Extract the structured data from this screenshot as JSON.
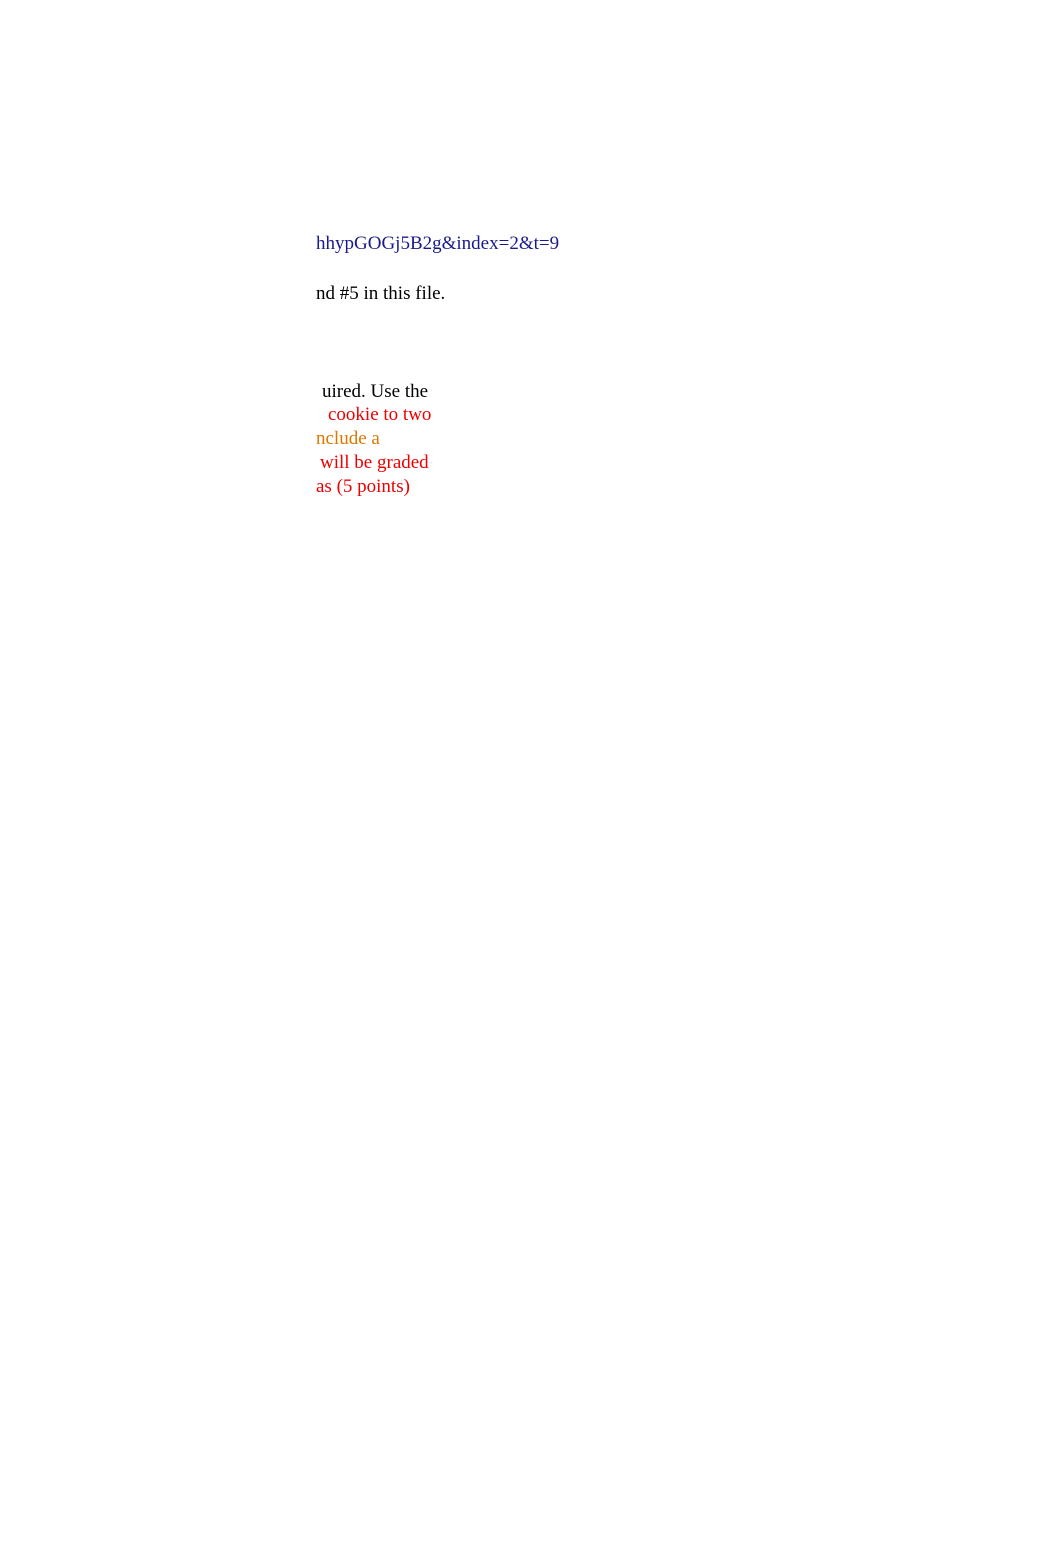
{
  "link": "hhypGOGj5B2g&index=2&t=9",
  "fileNote": "nd #5 in this file.",
  "instructions": {
    "line1": {
      "black": "uired. Use the"
    },
    "line2": {
      "red": "cookie to two"
    },
    "line3": {
      "orange": "nclude a"
    },
    "line4": {
      "red": "will be graded"
    },
    "line5": {
      "red": "as (5 points)"
    }
  }
}
